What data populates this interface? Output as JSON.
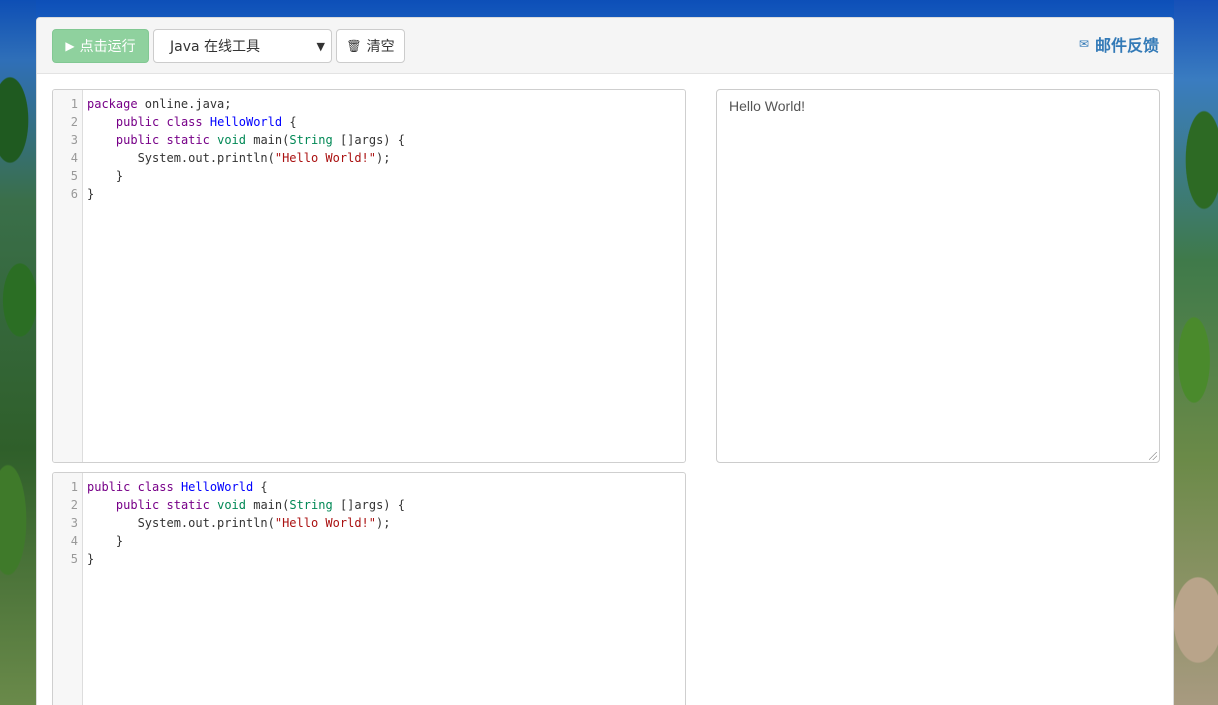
{
  "toolbar": {
    "run_label": "点击运行",
    "language_selected": "Java 在线工具",
    "clear_label": "清空",
    "feedback_label": "邮件反馈"
  },
  "editor_main": {
    "line_numbers": [
      "1",
      "2",
      "3",
      "4",
      "5",
      "6"
    ],
    "lines": [
      [
        {
          "t": "package",
          "c": "kw"
        },
        {
          "t": " online.java;",
          "c": ""
        }
      ],
      [
        {
          "t": "    ",
          "c": ""
        },
        {
          "t": "public",
          "c": "kw"
        },
        {
          "t": " ",
          "c": ""
        },
        {
          "t": "class",
          "c": "kw"
        },
        {
          "t": " ",
          "c": ""
        },
        {
          "t": "HelloWorld",
          "c": "def"
        },
        {
          "t": " {",
          "c": ""
        }
      ],
      [
        {
          "t": "    ",
          "c": ""
        },
        {
          "t": "public",
          "c": "kw"
        },
        {
          "t": " ",
          "c": ""
        },
        {
          "t": "static",
          "c": "kw"
        },
        {
          "t": " ",
          "c": ""
        },
        {
          "t": "void",
          "c": "ty"
        },
        {
          "t": " main(",
          "c": ""
        },
        {
          "t": "String",
          "c": "ty"
        },
        {
          "t": " []args) {",
          "c": ""
        }
      ],
      [
        {
          "t": "       System.out.println(",
          "c": ""
        },
        {
          "t": "\"Hello World!\"",
          "c": "str"
        },
        {
          "t": ");",
          "c": ""
        }
      ],
      [
        {
          "t": "    }",
          "c": ""
        }
      ],
      [
        {
          "t": "}",
          "c": ""
        }
      ]
    ]
  },
  "editor_secondary": {
    "line_numbers": [
      "1",
      "2",
      "3",
      "4",
      "5"
    ],
    "lines": [
      [
        {
          "t": "public",
          "c": "kw"
        },
        {
          "t": " ",
          "c": ""
        },
        {
          "t": "class",
          "c": "kw"
        },
        {
          "t": " ",
          "c": ""
        },
        {
          "t": "HelloWorld",
          "c": "def"
        },
        {
          "t": " {",
          "c": ""
        }
      ],
      [
        {
          "t": "    ",
          "c": ""
        },
        {
          "t": "public",
          "c": "kw"
        },
        {
          "t": " ",
          "c": ""
        },
        {
          "t": "static",
          "c": "kw"
        },
        {
          "t": " ",
          "c": ""
        },
        {
          "t": "void",
          "c": "ty"
        },
        {
          "t": " main(",
          "c": ""
        },
        {
          "t": "String",
          "c": "ty"
        },
        {
          "t": " []args) {",
          "c": ""
        }
      ],
      [
        {
          "t": "       System.out.println(",
          "c": ""
        },
        {
          "t": "\"Hello World!\"",
          "c": "str"
        },
        {
          "t": ");",
          "c": ""
        }
      ],
      [
        {
          "t": "    }",
          "c": ""
        }
      ],
      [
        {
          "t": "}",
          "c": ""
        }
      ]
    ]
  },
  "output": {
    "text": "Hello World!"
  },
  "colors": {
    "run_button": "#8fd19e",
    "link": "#337ab7",
    "keyword": "#770088",
    "class_name": "#0000ff",
    "type": "#008855",
    "string": "#aa1111"
  },
  "icons": {
    "run": "play-icon",
    "clear": "trash-icon",
    "feedback": "envelope-icon"
  }
}
